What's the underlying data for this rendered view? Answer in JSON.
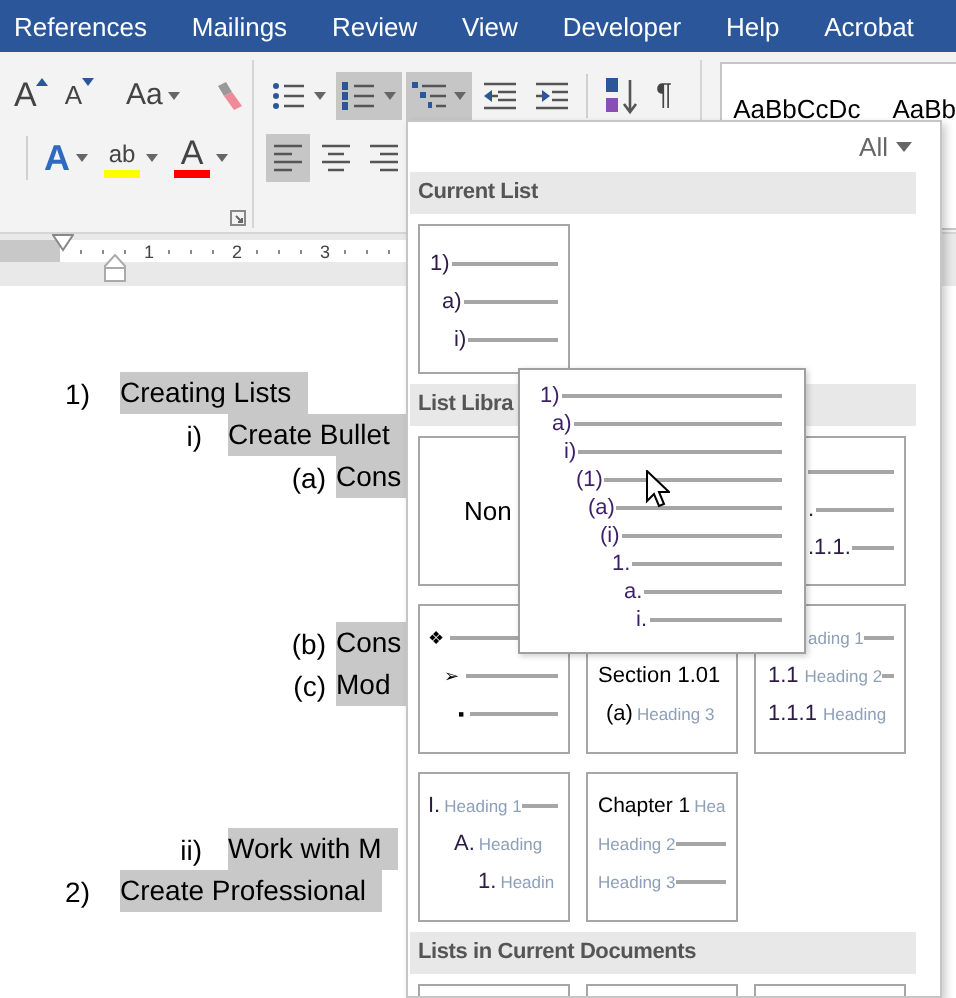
{
  "tabs": [
    {
      "label": "References",
      "selected": false
    },
    {
      "label": "Mailings",
      "selected": false
    },
    {
      "label": "Review",
      "selected": false
    },
    {
      "label": "View",
      "selected": false
    },
    {
      "label": "Developer",
      "selected": false
    },
    {
      "label": "Help",
      "selected": false
    },
    {
      "label": "Acrobat",
      "selected": false
    }
  ],
  "ribbon": {
    "font_tools": [
      {
        "kind": "grow",
        "label": "A",
        "selected": false
      },
      {
        "kind": "shrink",
        "label": "A",
        "selected": false
      },
      {
        "kind": "case",
        "label": "Aa",
        "selected": false
      },
      {
        "kind": "clear",
        "selected": false
      },
      {
        "kind": "effects",
        "label": "A",
        "selected": false
      },
      {
        "kind": "highlight",
        "label": "ab",
        "color": "#ffff00",
        "selected": false
      },
      {
        "kind": "fontcolor",
        "label": "A",
        "color": "#ff0000",
        "selected": false
      }
    ],
    "paragraph_tools": [
      {
        "kind": "bullets",
        "selected": false
      },
      {
        "kind": "numbering",
        "selected": true
      },
      {
        "kind": "multilevel",
        "selected": true
      },
      {
        "kind": "outdent",
        "selected": false
      },
      {
        "kind": "indent",
        "selected": false
      },
      {
        "kind": "sort",
        "selected": false
      },
      {
        "kind": "marks",
        "label": "¶",
        "selected": false
      },
      {
        "kind": "left",
        "selected": true
      },
      {
        "kind": "center",
        "selected": false
      },
      {
        "kind": "right",
        "selected": false
      }
    ],
    "styles": [
      "AaBbCcDc",
      "AaBb"
    ]
  },
  "ruler": {
    "numbers": [
      "1",
      "2",
      "3"
    ]
  },
  "document": {
    "items": [
      {
        "marker": "1)",
        "text": "Creating Lists",
        "highlighted": true,
        "children": [
          {
            "marker": "i)",
            "text": "Create Bullet",
            "highlighted": true,
            "children": [
              {
                "marker": "(a)",
                "text": "Cons",
                "highlighted": true
              },
              {
                "marker": "(b)",
                "text": "Cons",
                "highlighted": true
              },
              {
                "marker": "(c)",
                "text": "Mod",
                "highlighted": true
              }
            ]
          },
          {
            "marker": "ii)",
            "text": "Work with M",
            "highlighted": true
          }
        ]
      },
      {
        "marker": "2)",
        "text": "Create Professional",
        "highlighted": true
      }
    ]
  },
  "list_panel": {
    "filter": "All",
    "sections": [
      {
        "title": "Current List",
        "thumbnails": [
          {
            "kind": "outline",
            "rows": [
              {
                "number": "1)",
                "line": true
              },
              {
                "number": "a)",
                "line": true
              },
              {
                "number": "i)",
                "line": true
              }
            ]
          }
        ]
      },
      {
        "title": "List Libra",
        "thumbnails": [
          {
            "kind": "none",
            "label": "Non"
          },
          {
            "kind": "covered"
          },
          {
            "kind": "offset",
            "rows": [
              {
                "line": true
              },
              {
                "number": ".",
                "line": true
              },
              {
                "number": ".1.1.",
                "line": true
              }
            ]
          },
          {
            "kind": "bullets",
            "rows": [
              {
                "number": "❖",
                "line": true
              },
              {
                "number": "➢",
                "line": true
              },
              {
                "number": "▪",
                "line": true
              }
            ]
          },
          {
            "kind": "legal",
            "rows": [
              {
                "number": "Section 1.01",
                "line": false
              },
              {
                "number": "(a)",
                "heading": "Heading 3",
                "line": false
              }
            ]
          },
          {
            "kind": "numbered",
            "rows": [
              {
                "heading": "ading 1",
                "line": true
              },
              {
                "number": "1.1",
                "heading": "Heading 2",
                "line": true
              },
              {
                "number": "1.1.1",
                "heading": "Heading",
                "line": false
              }
            ]
          },
          {
            "kind": "outline-headings",
            "rows": [
              {
                "number": "I.",
                "heading": "Heading 1",
                "line": true
              },
              {
                "number": "A.",
                "heading": "Heading",
                "line": false
              },
              {
                "number": "1.",
                "heading": "Headin",
                "line": false
              }
            ]
          },
          {
            "kind": "chapter",
            "rows": [
              {
                "number": "Chapter 1",
                "heading": "Hea",
                "line": false
              },
              {
                "heading": "Heading 2",
                "line": true
              },
              {
                "heading": "Heading 3",
                "line": true
              }
            ]
          }
        ]
      },
      {
        "title": "Lists in Current Documents",
        "thumbnails": [
          {
            "kind": "cut"
          },
          {
            "kind": "cut"
          },
          {
            "kind": "cut"
          }
        ]
      }
    ],
    "preview": {
      "rows": [
        "1)",
        "a)",
        "i)",
        "(1)",
        "(a)",
        "(i)",
        "1.",
        "a.",
        "i."
      ]
    }
  }
}
